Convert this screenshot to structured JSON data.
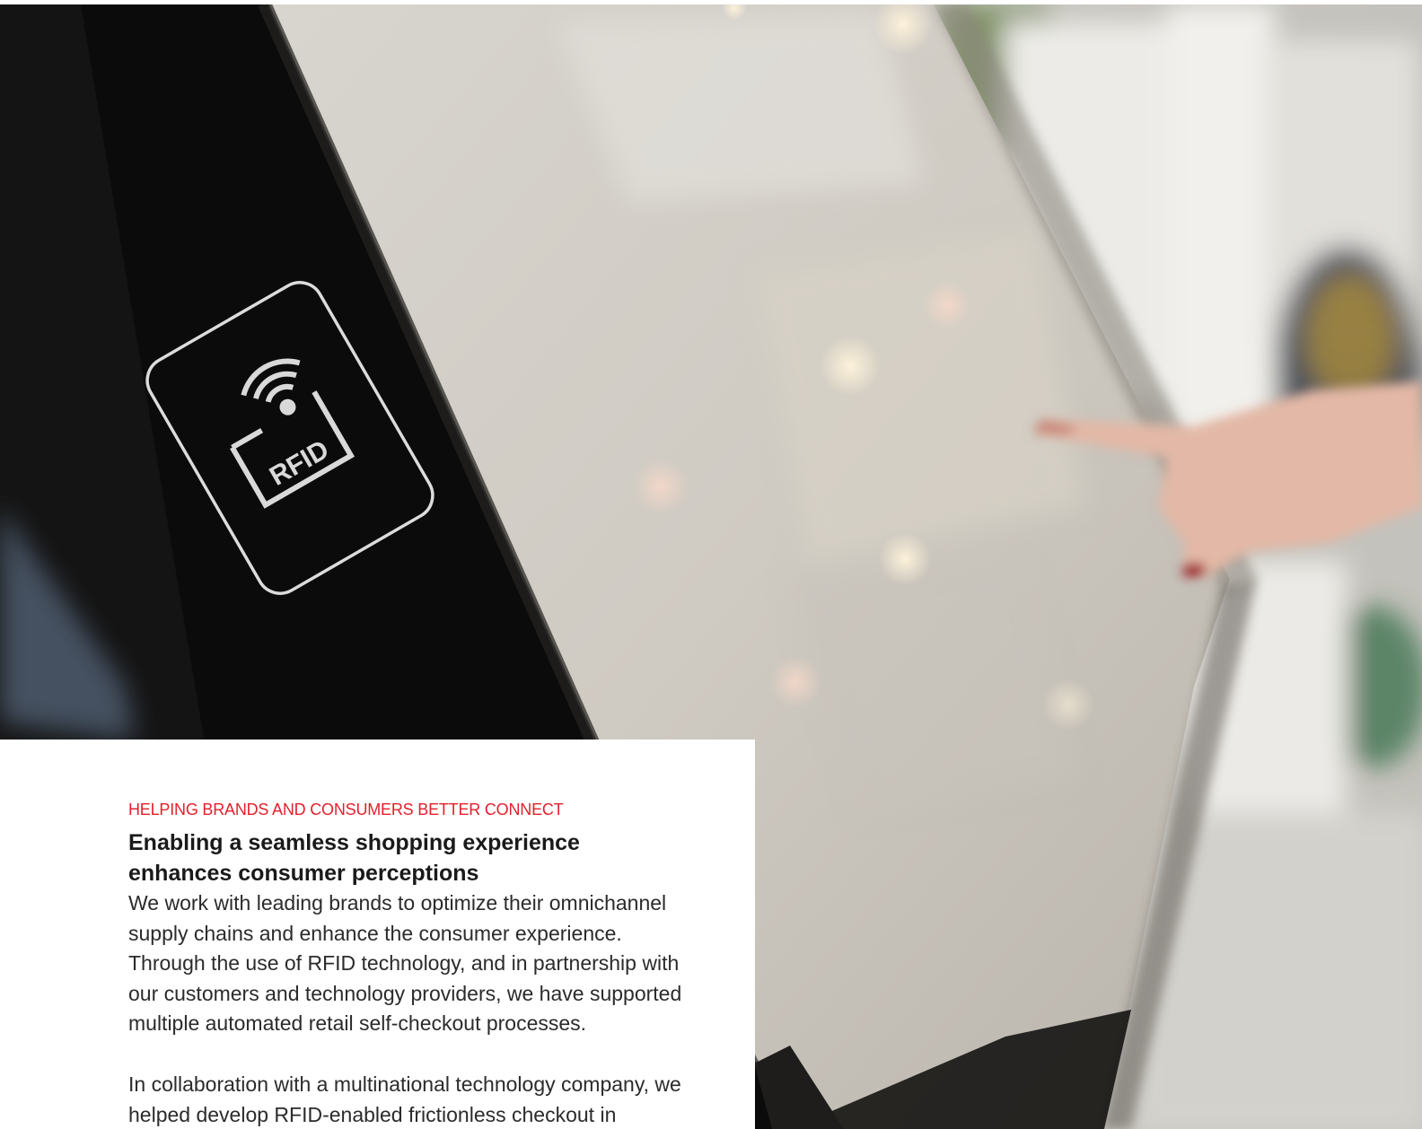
{
  "hero": {
    "kiosk_label": "RFID"
  },
  "card": {
    "eyebrow": "HELPING BRANDS AND CONSUMERS BETTER CONNECT",
    "heading": "Enabling a seamless shopping experience enhances consumer perceptions",
    "paragraphs": [
      "We work with leading brands to optimize their omnichannel supply chains and enhance the consumer experience. Through the use of RFID technology, and in partnership with our customers and technology providers, we have supported multiple automated retail self-checkout processes.",
      "In collaboration with a multinational technology company, we helped develop RFID-enabled frictionless checkout in"
    ]
  },
  "colors": {
    "accent": "#e4202b",
    "heading": "#1a1a1a",
    "body": "#2b2b2b",
    "kiosk_bezel": "#0c0c0c",
    "kiosk_screen": "#cdc9c2"
  },
  "icons": {
    "rfid": "rfid-reader-icon"
  }
}
